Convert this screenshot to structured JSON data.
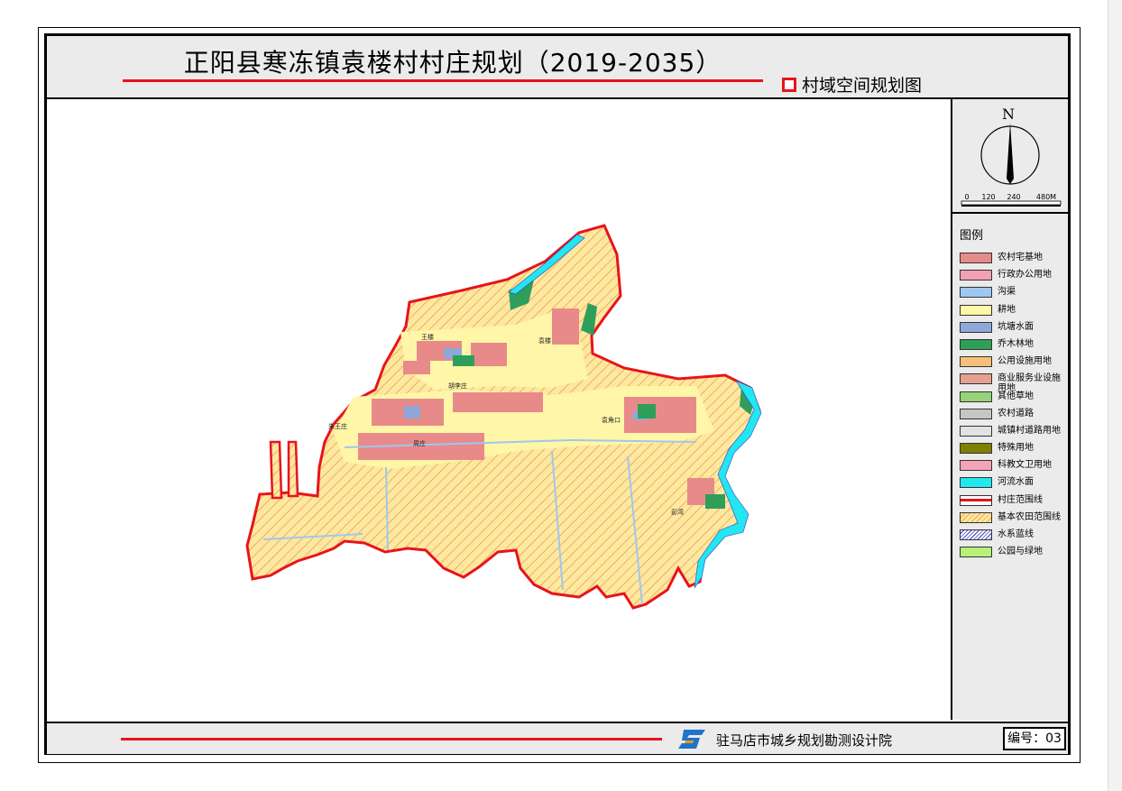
{
  "title": "正阳县寒冻镇袁楼村村庄规划（2019-2035）",
  "subtitle": "村域空间规划图",
  "north_label": "N",
  "scale_labels": [
    "0",
    "120",
    "240",
    "480M"
  ],
  "legend": {
    "title": "图例",
    "items": [
      {
        "label": "农村宅基地",
        "color": "#e88a8a",
        "style": "fill"
      },
      {
        "label": "行政办公用地",
        "color": "#f3a0b4",
        "style": "fill"
      },
      {
        "label": "沟渠",
        "color": "#9ec8ef",
        "style": "fill"
      },
      {
        "label": "耕地",
        "color": "#fff6a8",
        "style": "fill"
      },
      {
        "label": "坑塘水面",
        "color": "#8fa8d8",
        "style": "fill"
      },
      {
        "label": "乔木林地",
        "color": "#2f9e5a",
        "style": "fill"
      },
      {
        "label": "公用设施用地",
        "color": "#f7c07a",
        "style": "fill"
      },
      {
        "label": "商业服务业设施用地",
        "color": "#e5a08f",
        "style": "fill"
      },
      {
        "label": "其他草地",
        "color": "#96d27a",
        "style": "fill"
      },
      {
        "label": "农村道路",
        "color": "#c6c6c6",
        "style": "fill"
      },
      {
        "label": "城镇村道路用地",
        "color": "#e2e2e2",
        "style": "fill"
      },
      {
        "label": "特殊用地",
        "color": "#808000",
        "style": "fill"
      },
      {
        "label": "科教文卫用地",
        "color": "#f4a3b8",
        "style": "fill"
      },
      {
        "label": "河流水面",
        "color": "#22e6f0",
        "style": "fill"
      },
      {
        "label": "村庄范围线",
        "color": "#e8141b",
        "style": "line"
      },
      {
        "label": "基本农田范围线",
        "color": "#f3a64a",
        "style": "hatch"
      },
      {
        "label": "水系蓝线",
        "color": "#3c3cc8",
        "style": "hatch-blue"
      },
      {
        "label": "公园与绿地",
        "color": "#b8f07a",
        "style": "fill"
      }
    ]
  },
  "place_labels": [
    "王楼",
    "袁楼",
    "胡李庄",
    "朱王庄",
    "周庄",
    "袁角口",
    "彭湾"
  ],
  "footer": {
    "org": "驻马店市城乡规划勘测设计院",
    "number": "编号：03"
  },
  "colors": {
    "boundary": "#e8141b",
    "farmland": "#fde39a",
    "hatch": "#f0a040",
    "water": "#22e6f0",
    "forest": "#2f9e5a",
    "residential": "#e88a8a"
  }
}
